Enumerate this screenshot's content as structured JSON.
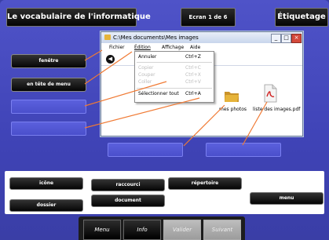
{
  "header": {
    "title": "Le vocabulaire de l'informatique",
    "screen_indicator": "Ecran 1 de 6",
    "tag_button": "Étiquetage"
  },
  "window": {
    "title_path": "C:\\Mes documents\\Mes images",
    "menu": [
      "Fichier",
      "Édition",
      "Affichage",
      "Aide"
    ],
    "controls": [
      "_",
      "□",
      "×"
    ],
    "edition_menu": [
      {
        "label": "Annuler",
        "shortcut": "Ctrl+Z",
        "enabled": true
      },
      {
        "label": "Copier",
        "shortcut": "Ctrl+C",
        "enabled": false
      },
      {
        "label": "Couper",
        "shortcut": "Ctrl+X",
        "enabled": false
      },
      {
        "label": "Coller",
        "shortcut": "Ctrl+V",
        "enabled": false
      },
      {
        "label": "Sélectionner tout",
        "shortcut": "Ctrl+A",
        "enabled": true
      }
    ],
    "files": [
      {
        "name": "mes photos",
        "icon": "folder-icon"
      },
      {
        "name": "liste des images.pdf",
        "icon": "pdf-icon"
      }
    ]
  },
  "labels_placed": [
    "fenêtre",
    "en tête de menu"
  ],
  "word_bank": [
    "icône",
    "raccourci",
    "répertoire",
    "dossier",
    "document",
    "menu"
  ],
  "nav": {
    "menu": "Menu",
    "info": "Info",
    "validate": "Valider",
    "next": "Suivant"
  },
  "colors": {
    "background": "#3f43b6",
    "button": "#0a0a0a",
    "connector": "#f07a34",
    "folder": "#e6b43a"
  }
}
